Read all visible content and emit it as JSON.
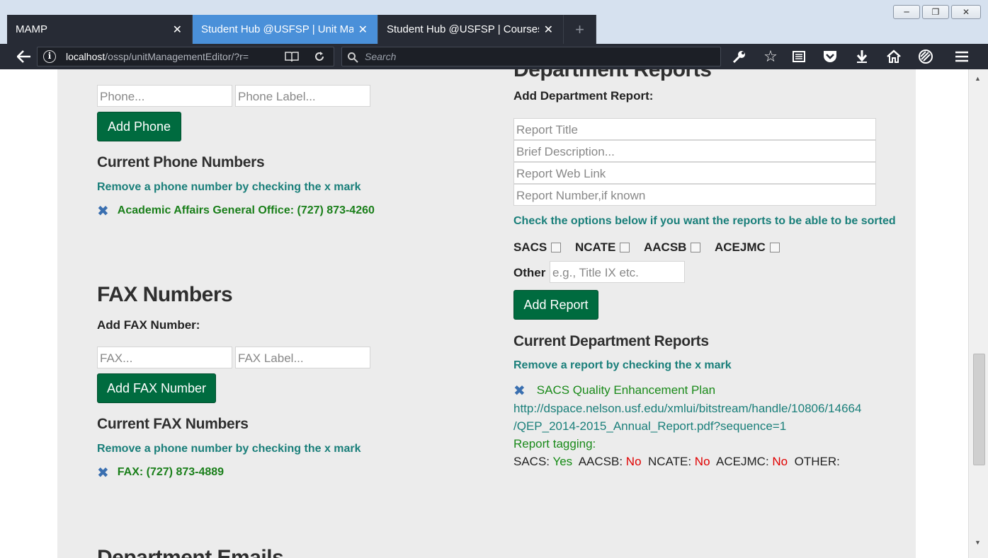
{
  "browser": {
    "tabs": [
      {
        "label": "MAMP"
      },
      {
        "label": "Student Hub @USFSP | Unit Management Editor"
      },
      {
        "label": "Student Hub @USFSP | Courses"
      }
    ],
    "new_tab": "+",
    "url_host": "localhost",
    "url_path": "/ossp/unitManagementEditor/?r=",
    "search_placeholder": "Search"
  },
  "phone": {
    "phone_placeholder": "Phone...",
    "label_placeholder": "Phone Label...",
    "add_button": "Add Phone",
    "current_heading": "Current Phone Numbers",
    "hint": "Remove a phone number by checking the x mark",
    "entries": [
      "Academic Affairs General Office: (727) 873-4260"
    ]
  },
  "fax": {
    "heading": "FAX Numbers",
    "add_label": "Add FAX Number:",
    "fax_placeholder": "FAX...",
    "label_placeholder": "FAX Label...",
    "add_button": "Add FAX Number",
    "current_heading": "Current FAX Numbers",
    "hint": "Remove a phone number by checking the x mark",
    "entries": [
      "FAX: (727) 873-4889"
    ]
  },
  "next_section_heading": "Department Emails",
  "reports": {
    "heading": "Department Reports",
    "add_label": "Add Department Report:",
    "title_placeholder": "Report Title",
    "desc_placeholder": "Brief Description...",
    "link_placeholder": "Report Web Link",
    "number_placeholder": "Report Number,if known",
    "sort_hint": "Check the options below if you want the reports to be able to be sorted",
    "options": [
      "SACS",
      "NCATE",
      "AACSB",
      "ACEJMC"
    ],
    "other_label": "Other",
    "other_placeholder": "e.g., Title IX etc.",
    "add_button": "Add Report",
    "current_heading": "Current Department Reports",
    "hint": "Remove a report by checking the x mark",
    "entry": {
      "title": "SACS Quality Enhancement Plan",
      "link_line1": "http://dspace.nelson.usf.edu/xmlui/bitstream/handle/10806/14664",
      "link_line2": "/QEP_2014-2015_Annual_Report.pdf?sequence=1",
      "tagging_label": "Report tagging:",
      "tags": {
        "sacs_label": "SACS:",
        "sacs_value": "Yes",
        "aacsb_label": "AACSB:",
        "aacsb_value": "No",
        "ncate_label": "NCATE:",
        "ncate_value": "No",
        "acejmc_label": "ACEJMC:",
        "acejmc_value": "No",
        "other_label": "OTHER:"
      }
    }
  },
  "colors": {
    "button_green": "#006b3f",
    "teal_text": "#1a7f7a",
    "remove_x": "#3a6fb0",
    "active_tab": "#4a90d9"
  }
}
